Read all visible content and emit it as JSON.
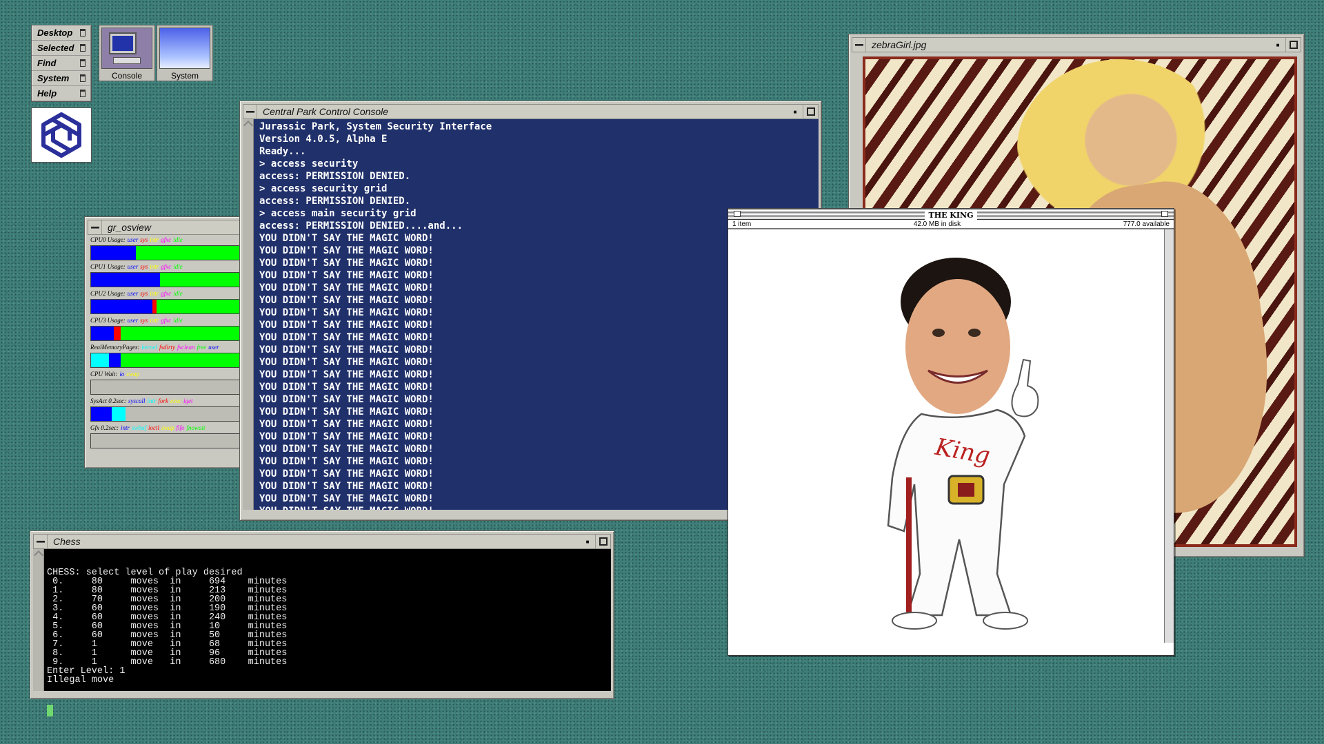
{
  "toolchest": {
    "items": [
      {
        "label": "Desktop"
      },
      {
        "label": "Selected"
      },
      {
        "label": "Find"
      },
      {
        "label": "System"
      },
      {
        "label": "Help"
      }
    ]
  },
  "desktop_icons": [
    {
      "label": "Console",
      "icon": "console-monitor-icon"
    },
    {
      "label": "System",
      "icon": "system-gradient-icon"
    }
  ],
  "console_window": {
    "title": "Central Park Control Console",
    "lines": [
      "Jurassic Park, System Security Interface",
      "Version 4.0.5, Alpha E",
      "Ready...",
      "> access security",
      "access: PERMISSION DENIED.",
      "> access security grid",
      "access: PERMISSION DENIED.",
      "> access main security grid",
      "access: PERMISSION DENIED....and...",
      "YOU DIDN'T SAY THE MAGIC WORD!",
      "YOU DIDN'T SAY THE MAGIC WORD!",
      "YOU DIDN'T SAY THE MAGIC WORD!",
      "YOU DIDN'T SAY THE MAGIC WORD!",
      "YOU DIDN'T SAY THE MAGIC WORD!",
      "YOU DIDN'T SAY THE MAGIC WORD!",
      "YOU DIDN'T SAY THE MAGIC WORD!",
      "YOU DIDN'T SAY THE MAGIC WORD!",
      "YOU DIDN'T SAY THE MAGIC WORD!",
      "YOU DIDN'T SAY THE MAGIC WORD!",
      "YOU DIDN'T SAY THE MAGIC WORD!",
      "YOU DIDN'T SAY THE MAGIC WORD!",
      "YOU DIDN'T SAY THE MAGIC WORD!",
      "YOU DIDN'T SAY THE MAGIC WORD!",
      "YOU DIDN'T SAY THE MAGIC WORD!",
      "YOU DIDN'T SAY THE MAGIC WORD!",
      "YOU DIDN'T SAY THE MAGIC WORD!",
      "YOU DIDN'T SAY THE MAGIC WORD!",
      "YOU DIDN'T SAY THE MAGIC WORD!",
      "YOU DIDN'T SAY THE MAGIC WORD!",
      "YOU DIDN'T SAY THE MAGIC WORD!",
      "YOU DIDN'T SAY THE MAGIC WORD!",
      "YOU DIDN'T SAY THE MAGIC WORD!"
    ]
  },
  "osview": {
    "title": "gr_osview",
    "rows": [
      {
        "label": "CPU0 Usage:",
        "legend": [
          [
            "user",
            "#0000ff"
          ],
          [
            "sys",
            "#ff0000"
          ],
          [
            "intr",
            "#ffff00"
          ],
          [
            "gfxc",
            "#ff00ff"
          ],
          [
            "idle",
            "#00ff00"
          ]
        ],
        "segments": [
          [
            "#0000ff",
            0.3
          ],
          [
            "#00ff00",
            0.7
          ]
        ]
      },
      {
        "label": "CPU1 Usage:",
        "legend": [
          [
            "user",
            "#0000ff"
          ],
          [
            "sys",
            "#ff0000"
          ],
          [
            "intr",
            "#ffff00"
          ],
          [
            "gfxc",
            "#ff00ff"
          ],
          [
            "idle",
            "#00ff00"
          ]
        ],
        "segments": [
          [
            "#0000ff",
            0.46
          ],
          [
            "#00ff00",
            0.54
          ]
        ]
      },
      {
        "label": "CPU2 Usage:",
        "legend": [
          [
            "user",
            "#0000ff"
          ],
          [
            "sys",
            "#ff0000"
          ],
          [
            "intr",
            "#ffff00"
          ],
          [
            "gfxc",
            "#ff00ff"
          ],
          [
            "idle",
            "#00ff00"
          ]
        ],
        "segments": [
          [
            "#0000ff",
            0.41
          ],
          [
            "#ff0000",
            0.03
          ],
          [
            "#00ff00",
            0.56
          ]
        ]
      },
      {
        "label": "CPU3 Usage:",
        "legend": [
          [
            "user",
            "#0000ff"
          ],
          [
            "sys",
            "#ff0000"
          ],
          [
            "intr",
            "#ffff00"
          ],
          [
            "gfxc",
            "#ff00ff"
          ],
          [
            "idle",
            "#00ff00"
          ]
        ],
        "segments": [
          [
            "#0000ff",
            0.15
          ],
          [
            "#ff0000",
            0.05
          ],
          [
            "#00ff00",
            0.8
          ]
        ]
      },
      {
        "label": "RealMemoryPages:",
        "legend": [
          [
            "kernel",
            "#00ffff"
          ],
          [
            "fsdirty",
            "#ff0000"
          ],
          [
            "fsclean",
            "#ff00ff"
          ],
          [
            "free",
            "#00ff00"
          ],
          [
            "user",
            "#0000ff"
          ]
        ],
        "segments": [
          [
            "#00ffff",
            0.12
          ],
          [
            "#0000ff",
            0.08
          ],
          [
            "#00ff00",
            0.8
          ]
        ]
      },
      {
        "label": "CPU Wait:",
        "legend": [
          [
            "io",
            "#0000ff"
          ],
          [
            "swap",
            "#ffff00"
          ]
        ],
        "segments": []
      },
      {
        "label": "SysAct 0.2sec:",
        "legend": [
          [
            "syscall",
            "#0000ff"
          ],
          [
            "intr",
            "#00ffff"
          ],
          [
            "fork",
            "#ff0000"
          ],
          [
            "exec",
            "#ffff00"
          ],
          [
            "iget",
            "#ff00ff"
          ]
        ],
        "segments": [
          [
            "#0000ff",
            0.14
          ],
          [
            "#00ffff",
            0.09
          ]
        ]
      },
      {
        "label": "Gfx 0.2sec:",
        "legend": [
          [
            "intr",
            "#0000ff"
          ],
          [
            "swbuf",
            "#00ffff"
          ],
          [
            "ioctl",
            "#ff0000"
          ],
          [
            "swap",
            "#ffff00"
          ],
          [
            "fifo",
            "#ff00ff"
          ],
          [
            "fnowait",
            "#00ff00"
          ]
        ],
        "segments": []
      }
    ]
  },
  "chess_window": {
    "title": "Chess",
    "text": "CHESS: select level of play desired\n 0.     80     moves  in     694    minutes\n 1.     80     moves  in     213    minutes\n 2.     70     moves  in     200    minutes\n 3.     60     moves  in     190    minutes\n 4.     60     moves  in     240    minutes\n 5.     60     moves  in     10     minutes\n 6.     60     moves  in     50     minutes\n 7.     1      move   in     68     minutes\n 8.     1      move   in     96     minutes\n 9.     1      move   in     680    minutes\nEnter Level: 1\nIllegal move"
  },
  "zebra_window": {
    "title": "zebraGirl.jpg"
  },
  "finder_window": {
    "title": "THE KING",
    "items": "1 item",
    "disk": "42.0 MB in disk",
    "available": "777.0 available",
    "caricature_text": "King"
  },
  "colors": {
    "console_bg": "#20306a",
    "desktop": "#3f7f79",
    "chrome": "#c9c9c1"
  }
}
